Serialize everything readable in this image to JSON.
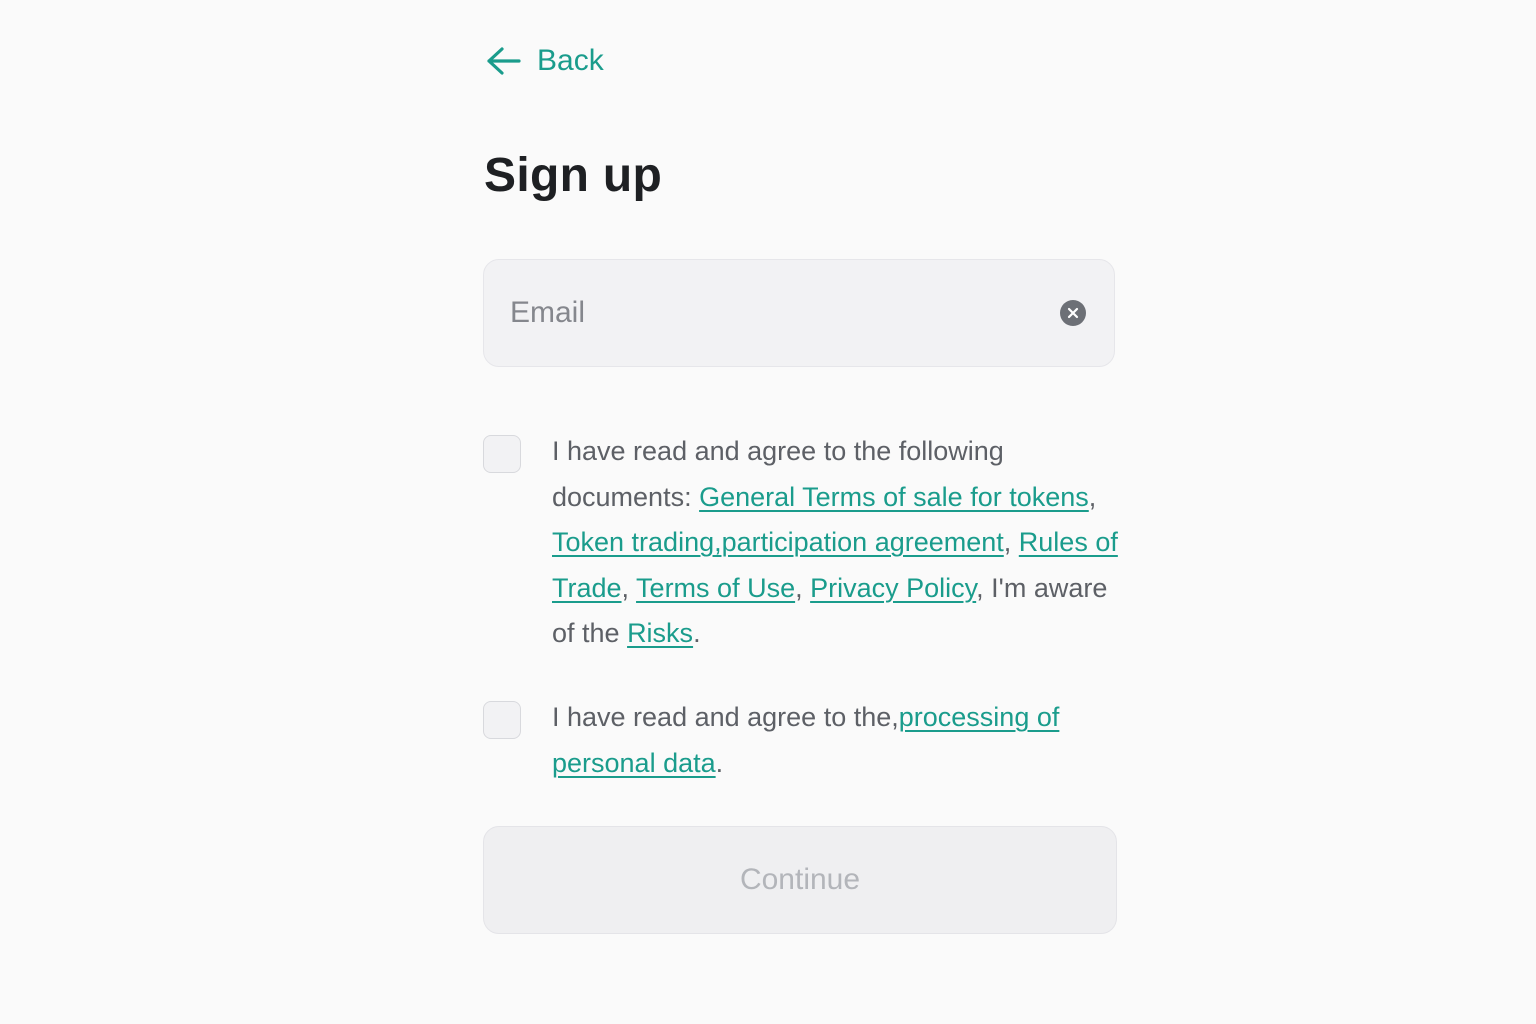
{
  "nav": {
    "back_label": "Back"
  },
  "page": {
    "title": "Sign up"
  },
  "email_field": {
    "placeholder": "Email",
    "value": ""
  },
  "agreement1": {
    "checked": false,
    "text_intro": "I have read and agree to the following documents: ",
    "link_general_terms": "General Terms of sale for tokens",
    "link_token_trading": "Token trading,participation agreement",
    "link_rules_of_trade": "Rules of Trade",
    "link_terms_of_use": "Terms of Use",
    "link_privacy_policy": "Privacy Policy",
    "text_aware": "I'm aware of the ",
    "link_risks": "Risks"
  },
  "agreement2": {
    "checked": false,
    "text_intro": "I have read and agree to the,",
    "link_personal_data": "processing of personal data"
  },
  "actions": {
    "continue_label": "Continue"
  },
  "colors": {
    "accent": "#1a9c8c",
    "background": "#fafafa",
    "title_text": "#1e2023",
    "body_text": "#5d6066",
    "input_bg": "#f2f2f4",
    "disabled_button_bg": "#efeff1",
    "disabled_button_text": "#b3b5ba"
  },
  "icons": {
    "back": "arrow-left-icon",
    "clear": "clear-circle-icon"
  }
}
